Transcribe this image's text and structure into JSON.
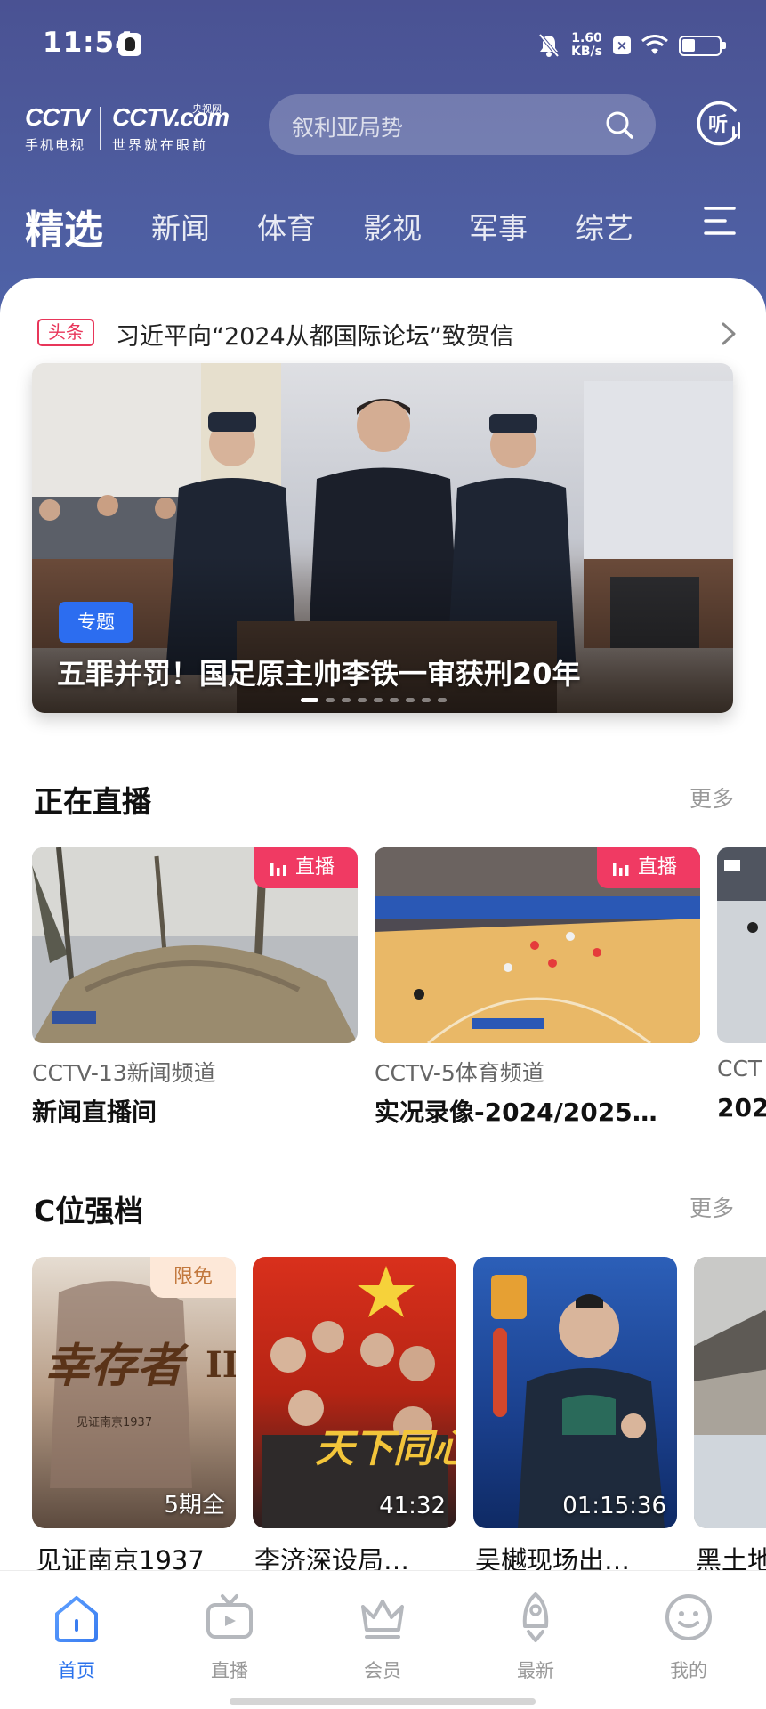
{
  "status_bar": {
    "time": "11:54",
    "speed_value": "1.60",
    "speed_unit": "KB/s",
    "icons": [
      "qq-icon",
      "mute-icon",
      "close-box-icon",
      "wifi-icon",
      "battery-icon"
    ]
  },
  "header": {
    "logo_left": "CCTV",
    "logo_left_sub": "手机电视",
    "logo_right": "CCTV.com",
    "logo_right_small": "央视网",
    "logo_right_sub": "世界就在眼前",
    "search_placeholder": "叙利亚局势",
    "listen_label": "听"
  },
  "tabs": [
    {
      "label": "精选",
      "active": true
    },
    {
      "label": "新闻",
      "active": false
    },
    {
      "label": "体育",
      "active": false
    },
    {
      "label": "影视",
      "active": false
    },
    {
      "label": "军事",
      "active": false
    },
    {
      "label": "综艺",
      "active": false
    }
  ],
  "headline": {
    "tag": "头条",
    "text": "习近平向“2024从都国际论坛”致贺信"
  },
  "hero": {
    "topic_tag": "专题",
    "title": "五罪并罚！国足原主帅李铁一审获刑20年",
    "dots": 9,
    "active_dot": 0
  },
  "live_section": {
    "title": "正在直播",
    "more": "更多",
    "badge": "直播",
    "items": [
      {
        "channel": "CCTV-13新闻频道",
        "title": "新闻直播间"
      },
      {
        "channel": "CCTV-5体育频道",
        "title": "实况录像-2024/2025…"
      },
      {
        "channel": "CCT",
        "title": "202"
      }
    ]
  },
  "c_section": {
    "title": "C位强档",
    "more": "更多",
    "items": [
      {
        "title": "见证南京1937",
        "label": "5期全",
        "badge": "限免",
        "poster_text": "幸存者",
        "poster_sub": "见证南京1937"
      },
      {
        "title": "李济深设局…",
        "label": "41:32",
        "poster_text": "天下同心"
      },
      {
        "title": "吴樾现场出…",
        "label": "01:15:36"
      },
      {
        "title": "黑土地",
        "label": ""
      }
    ]
  },
  "bottom_nav": [
    {
      "label": "首页",
      "icon": "home-icon",
      "active": true
    },
    {
      "label": "直播",
      "icon": "tv-icon",
      "active": false
    },
    {
      "label": "会员",
      "icon": "crown-icon",
      "active": false
    },
    {
      "label": "最新",
      "icon": "rocket-icon",
      "active": false
    },
    {
      "label": "我的",
      "icon": "profile-face-icon",
      "active": false
    }
  ],
  "colors": {
    "header_gradient_top": "#4a5293",
    "header_gradient_bottom": "#4f63a8",
    "accent_blue": "#2a72ec",
    "live_red": "#f03a63",
    "headline_red": "#e8365a",
    "free_badge_bg": "#fde8d8"
  }
}
